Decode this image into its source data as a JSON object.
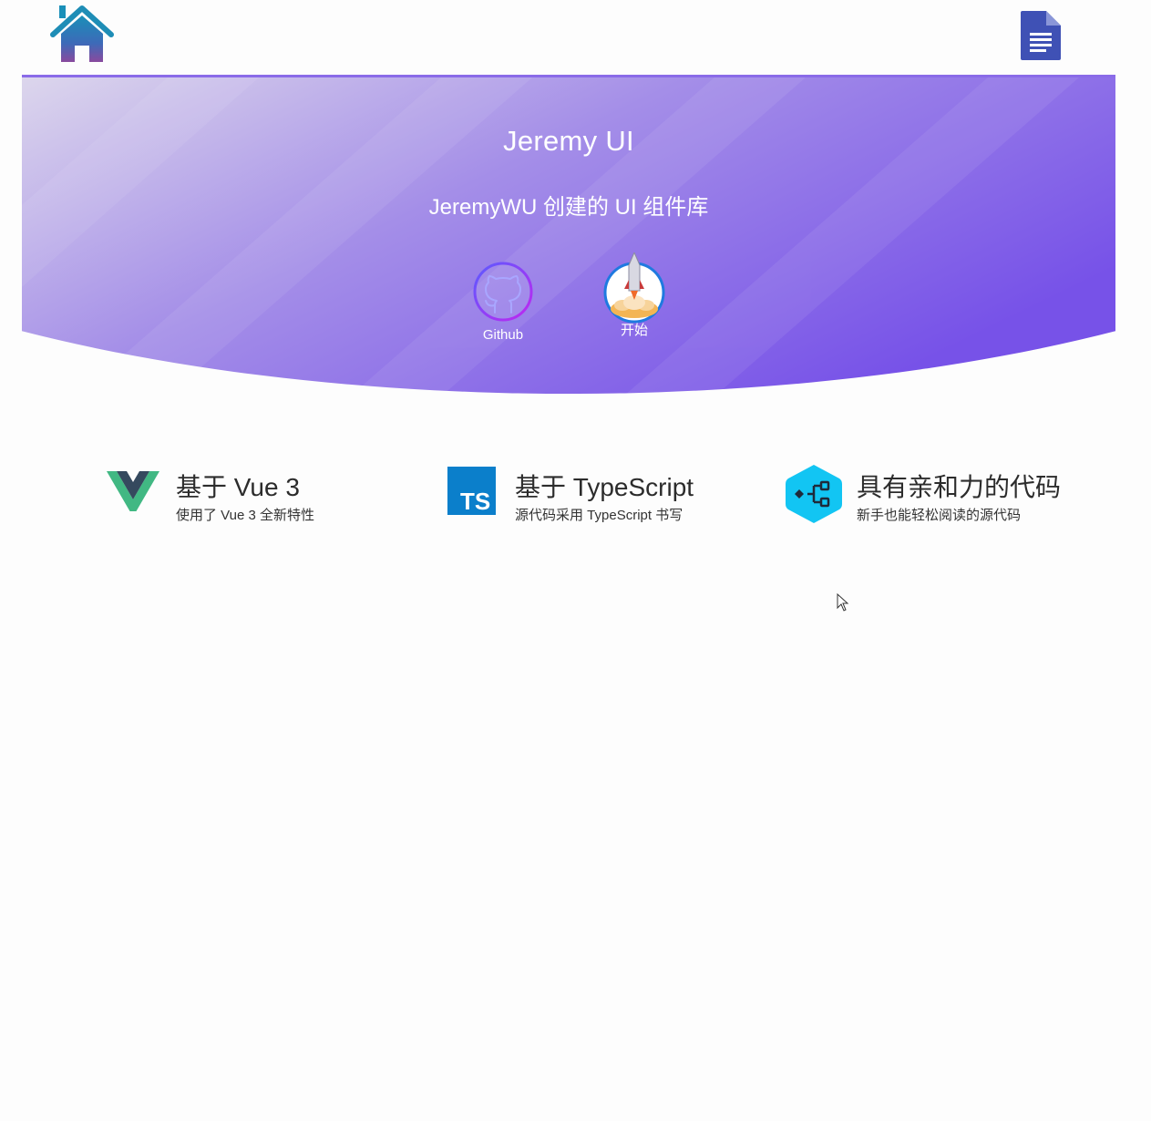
{
  "nav": {
    "home_icon": "home-icon",
    "docs_icon": "document-icon"
  },
  "banner": {
    "title": "Jeremy UI",
    "subtitle": "JeremyWU 创建的 UI 组件库",
    "actions": [
      {
        "label": "Github",
        "icon": "github-icon"
      },
      {
        "label": "开始",
        "icon": "rocket-icon"
      }
    ],
    "colors": {
      "gradient_start": "#dcd6ec",
      "gradient_mid": "#a48ee8",
      "gradient_end": "#7752e8"
    }
  },
  "features": [
    {
      "icon": "vue-logo-icon",
      "title": "基于 Vue 3",
      "desc": "使用了 Vue 3 全新特性"
    },
    {
      "icon": "typescript-logo-icon",
      "title": "基于 TypeScript",
      "desc": "源代码采用 TypeScript 书写"
    },
    {
      "icon": "code-structure-icon",
      "title": "具有亲和力的代码",
      "desc": "新手也能轻松阅读的源代码"
    }
  ]
}
